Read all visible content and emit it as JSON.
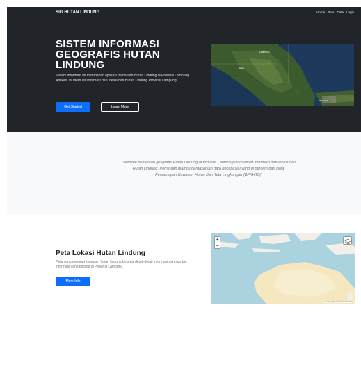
{
  "nav": {
    "brand": "SIG HUTAN LINDUNG",
    "items": [
      "Home",
      "Peta",
      "Data",
      "Login"
    ]
  },
  "hero": {
    "title": "SISTEM INFORMASI GEOGRAFIS HUTAN LINDUNG",
    "description": "Sistem informasi ini merupakan aplikasi pemetaan Hutan Lindung di Provinsi Lampung. Aplikasi ini memuat informasi dan lokasi dari Hutan Lindung Provinsi Lampung.",
    "primary_button": "Get Started",
    "secondary_button": "Learn More"
  },
  "quote": {
    "text": "\"Website pemetaan geografis Hutan Lindung di Provinsi Lampung ini memuat informasi dan lokasi dari Hutan Lindung. Pemetaan diambil berdasarkan data geospasial yang di peroleh dari Balai Pemantapan Kawasan Hutan Dan Tata Lingkungan (BPKHTL)\""
  },
  "map_section": {
    "title": "Peta Lokasi Hutan Lindung",
    "description": "Peta yang memuat kawasan hutan lindung beserta detail-detail informasi dan sumber informasi yang berada di Provinsi Lampung.",
    "button": "More Info",
    "zoom_in": "+",
    "zoom_out": "−",
    "attribution": "Leaflet | Map data © OpenStreetMap"
  },
  "colors": {
    "dark": "#212529",
    "primary": "#0d6efd",
    "light": "#f8f9fa",
    "muted": "#6c757d"
  }
}
